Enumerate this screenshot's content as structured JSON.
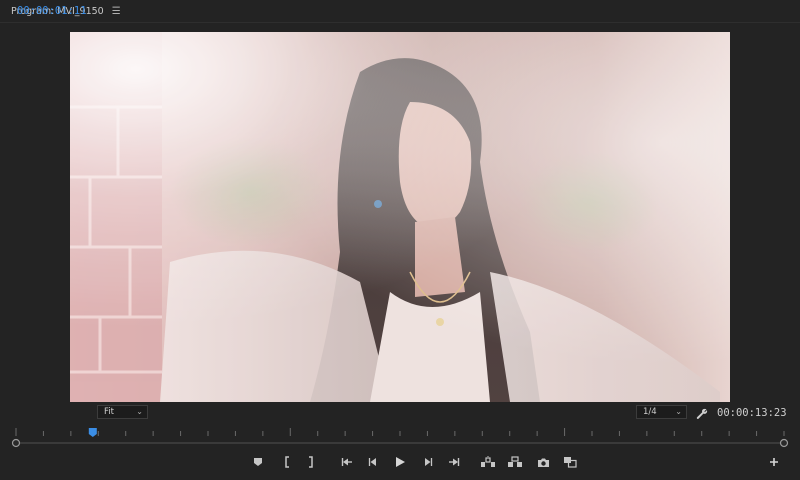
{
  "panel": {
    "title": "Program: MVI_9150",
    "menu_icon": "hamburger-menu-icon"
  },
  "timecode": {
    "current": "00:00:01:11",
    "duration": "00:00:13:23"
  },
  "zoom_select": {
    "selected": "Fit"
  },
  "resolution_select": {
    "selected": "1/4"
  },
  "playhead": {
    "position_fraction": 0.1
  },
  "transport": {
    "buttons": [
      "add-marker-icon",
      "mark-in-icon",
      "mark-out-icon",
      "go-to-in-icon",
      "step-back-icon",
      "play-icon",
      "step-forward-icon",
      "go-to-out-icon",
      "lift-icon",
      "extract-icon",
      "export-frame-icon",
      "comparison-view-icon"
    ],
    "add_button_icon": "plus-icon"
  },
  "colors": {
    "accent": "#3b8ee6",
    "panel_bg": "#232323"
  }
}
